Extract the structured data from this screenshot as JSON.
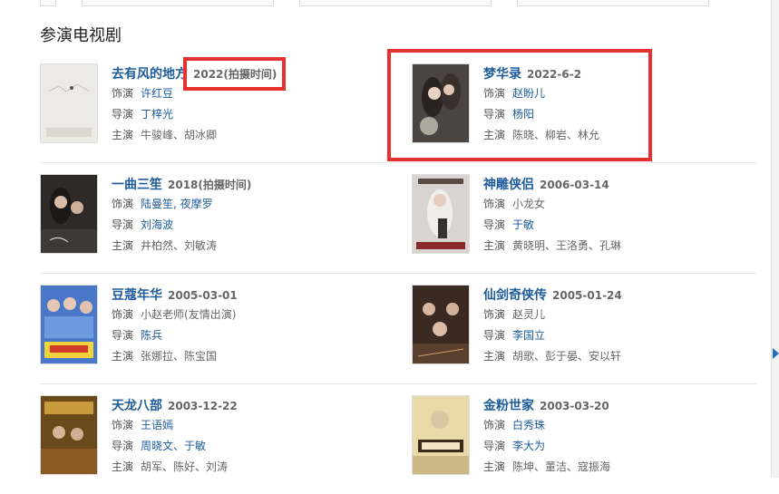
{
  "section": {
    "title": "参演电视剧"
  },
  "labels": {
    "role": "饰演",
    "director": "导演",
    "cast": "主演"
  },
  "dramas": [
    {
      "title": "去有风的地方",
      "date": "2022(拍摄时间)",
      "role": "许红豆",
      "director": "丁梓光",
      "cast": "牛骏峰、胡冰卿",
      "cast_link": false,
      "poster_bg": "#e9e6e0"
    },
    {
      "title": "梦华录",
      "date": "2022-6-2",
      "role": "赵盼儿",
      "director": "杨阳",
      "cast": "陈晓、柳岩、林允",
      "cast_link": false,
      "poster_bg": "#4b4440"
    },
    {
      "title": "一曲三笙",
      "date": "2018(拍摄时间)",
      "role": "陆曼笙, 夜摩罗",
      "director": "刘海波",
      "cast": "井柏然、刘敏涛",
      "cast_link": false,
      "poster_bg": "#2f2a28"
    },
    {
      "title": "神雕侠侣",
      "date": "2006-03-14",
      "role": "小龙女",
      "director": "于敏",
      "cast": "黄晓明、王洛勇、孔琳",
      "cast_link": false,
      "poster_bg": "#d9d4cf"
    },
    {
      "title": "豆蔻年华",
      "date": "2005-03-01",
      "role": "小赵老师(友情出演)",
      "director": "陈兵",
      "cast": "张娜拉、陈宝国",
      "cast_link": false,
      "poster_bg": "#4a78c8"
    },
    {
      "title": "仙剑奇侠传",
      "date": "2005-01-24",
      "role": "赵灵儿",
      "director": "李国立",
      "cast": "胡歌、彭于晏、安以轩",
      "cast_link": false,
      "poster_bg": "#3b2a22"
    },
    {
      "title": "天龙八部",
      "date": "2003-12-22",
      "role": "王语嫣",
      "director": "周晓文、于敏",
      "cast": "胡军、陈好、刘涛",
      "cast_link": false,
      "poster_bg": "#6a4a1a"
    },
    {
      "title": "金粉世家",
      "date": "2003-03-20",
      "role": "白秀珠",
      "director": "李大为",
      "cast": "陈坤、董洁、寇振海",
      "cast_link": false,
      "poster_bg": "#e8d9a8"
    }
  ],
  "colors": {
    "link": "#1e5b9a",
    "highlight": "#e8302f"
  }
}
